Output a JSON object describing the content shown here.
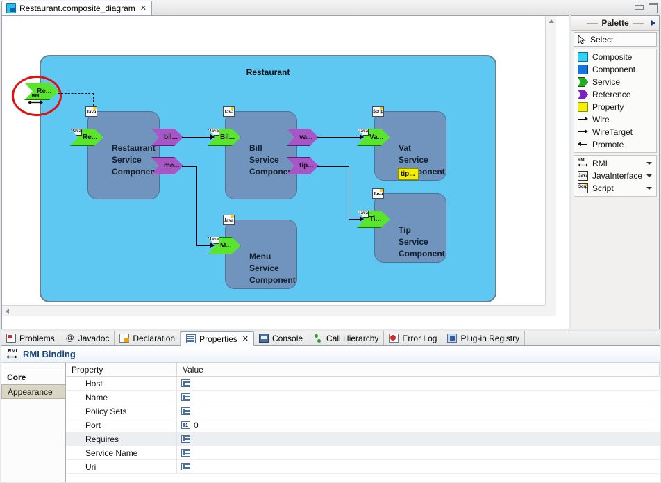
{
  "window": {
    "editor_tab": {
      "title": "Restaurant.composite_diagram",
      "close": "✕",
      "icon": "composite-diagram-icon"
    },
    "minimize_label": "minimize-icon",
    "maximize_label": "maximize-icon"
  },
  "diagram": {
    "composite_title": "Restaurant",
    "components": [
      {
        "name": "Restaurant Service Component",
        "lines": [
          "Restaurant",
          "Service",
          "Component"
        ],
        "badge": "Java",
        "badge_type": "java"
      },
      {
        "name": "Bill Service Component",
        "lines": [
          "Bill",
          "Service",
          "Component"
        ],
        "badge": "Java",
        "badge_type": "java"
      },
      {
        "name": "Menu Service Component",
        "lines": [
          "Menu",
          "Service",
          "Component"
        ],
        "badge": "Java",
        "badge_type": "java"
      },
      {
        "name": "Vat Service Component",
        "lines": [
          "Vat",
          "Service",
          "Component"
        ],
        "badge": "Script",
        "badge_type": "script"
      },
      {
        "name": "Tip Service Component",
        "lines": [
          "Tip",
          "Service",
          "Component"
        ],
        "badge": "Java",
        "badge_type": "java"
      }
    ],
    "promoted_service": {
      "label": "Re...",
      "binding": "RMI"
    },
    "ports": {
      "restaurant_service": "Re...",
      "restaurant_ref_bill": "bil...",
      "restaurant_ref_menu": "me...",
      "bill_service": "Bil...",
      "bill_ref_vat": "va...",
      "bill_ref_tip": "tip...",
      "vat_service": "Va...",
      "tip_service": "Ti...",
      "menu_service": "M..."
    },
    "property_box": "tip...",
    "colors": {
      "composite_fill": "#5ec8f2",
      "component_fill": "#7094bd",
      "service_port": "#5ae52d",
      "reference_port": "#a855c8",
      "property": "#f5f000",
      "annotation": "#e01010"
    }
  },
  "palette": {
    "title": "Palette",
    "select_label": "Select",
    "items": [
      {
        "label": "Composite",
        "icon": "composite-swatch-icon",
        "caret": false
      },
      {
        "label": "Component",
        "icon": "component-swatch-icon",
        "caret": false
      },
      {
        "label": "Service",
        "icon": "service-swatch-icon",
        "caret": false
      },
      {
        "label": "Reference",
        "icon": "reference-swatch-icon",
        "caret": false
      },
      {
        "label": "Property",
        "icon": "property-swatch-icon",
        "caret": false
      },
      {
        "label": "Wire",
        "icon": "wire-icon",
        "caret": false
      },
      {
        "label": "WireTarget",
        "icon": "wiretarget-icon",
        "caret": false
      },
      {
        "label": "Promote",
        "icon": "promote-icon",
        "caret": false
      }
    ],
    "bindings": [
      {
        "label": "RMI",
        "icon": "rmi-icon",
        "caret": true
      },
      {
        "label": "JavaInterface",
        "icon": "java-icon",
        "caret": true
      },
      {
        "label": "Script",
        "icon": "script-icon",
        "caret": true
      }
    ]
  },
  "bottom": {
    "tabs": [
      {
        "label": "Problems",
        "icon": "problems-icon",
        "active": false,
        "closable": false
      },
      {
        "label": "Javadoc",
        "icon": "javadoc-icon",
        "active": false,
        "closable": false
      },
      {
        "label": "Declaration",
        "icon": "declaration-icon",
        "active": false,
        "closable": false
      },
      {
        "label": "Properties",
        "icon": "properties-icon",
        "active": true,
        "closable": true
      },
      {
        "label": "Console",
        "icon": "console-icon",
        "active": false,
        "closable": false
      },
      {
        "label": "Call Hierarchy",
        "icon": "call-hierarchy-icon",
        "active": false,
        "closable": false
      },
      {
        "label": "Error Log",
        "icon": "error-log-icon",
        "active": false,
        "closable": false
      },
      {
        "label": "Plug-in Registry",
        "icon": "plugin-registry-icon",
        "active": false,
        "closable": false
      }
    ],
    "close_glyph": "✕",
    "properties": {
      "header_title": "RMI Binding",
      "header_icon": "rmi-icon",
      "side_tabs": [
        {
          "label": "Core",
          "active": true
        },
        {
          "label": "Appearance",
          "active": false
        }
      ],
      "columns": [
        "Property",
        "Value"
      ],
      "rows": [
        {
          "property": "Host",
          "value": "",
          "icon": "text-field-icon",
          "highlight": false
        },
        {
          "property": "Name",
          "value": "",
          "icon": "text-field-icon",
          "highlight": false
        },
        {
          "property": "Policy Sets",
          "value": "",
          "icon": "text-field-icon",
          "highlight": false
        },
        {
          "property": "Port",
          "value": "0",
          "icon": "number-field-icon",
          "highlight": false
        },
        {
          "property": "Requires",
          "value": "",
          "icon": "text-field-icon",
          "highlight": true
        },
        {
          "property": "Service Name",
          "value": "",
          "icon": "text-field-icon",
          "highlight": false
        },
        {
          "property": "Uri",
          "value": "",
          "icon": "text-field-icon",
          "highlight": false
        }
      ]
    }
  }
}
